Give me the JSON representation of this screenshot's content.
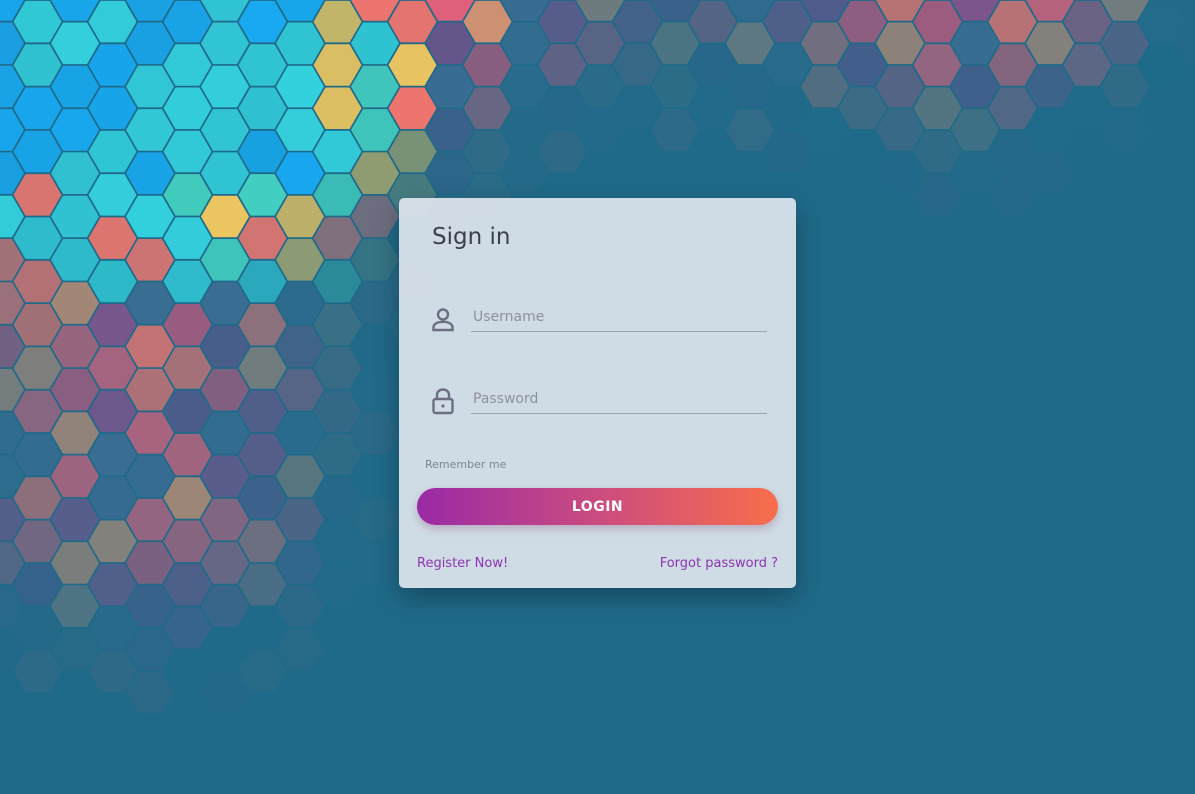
{
  "colors": {
    "page_background": "#1f6a89",
    "card_background": "#e2e8f0",
    "button_gradient_start": "#9a2aa6",
    "button_gradient_end": "#f86e4b",
    "link": "#8d35b1"
  },
  "form": {
    "title": "Sign in",
    "username": {
      "icon": "user-icon",
      "placeholder": "Username",
      "value": ""
    },
    "password": {
      "icon": "lock-icon",
      "placeholder": "Password",
      "value": ""
    },
    "remember_label": "Remember me",
    "login_label": "LOGIN",
    "register_link": "Register Now!",
    "forgot_link": "Forgot password ?"
  }
}
